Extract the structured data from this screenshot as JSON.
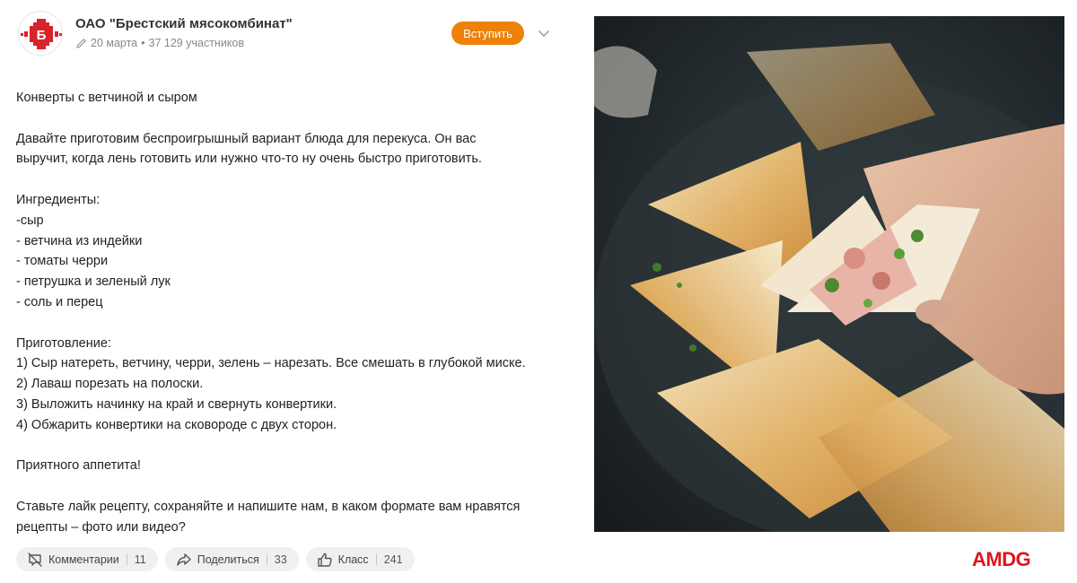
{
  "header": {
    "group_name": "ОАО \"Брестский мясокомбинат\"",
    "date": "20 марта",
    "members": "37 129 участников",
    "join_label": "Вступить",
    "icons": {
      "pencil": "pencil-icon",
      "more": "chevron-down-icon",
      "logo": "group-logo"
    }
  },
  "post": {
    "paragraphs": [
      [
        "Конверты с ветчиной и сыром"
      ],
      [
        "Давайте приготовим беспроигрышный вариант блюда для перекуса. Он вас",
        "выручит, когда лень готовить или нужно что-то ну очень быстро приготовить."
      ],
      [
        "Ингредиенты:",
        "-сыр",
        "- ветчина из индейки",
        "- томаты черри",
        "- петрушка и зеленый лук",
        "- соль и перец"
      ],
      [
        "Приготовление:",
        "1) Сыр натереть, ветчину, черри, зелень – нарезать. Все смешать в глубокой миске.",
        "2) Лаваш порезать на полоски.",
        "3) Выложить начинку на край и свернуть конвертики.",
        "4) Обжарить конвертики на сковороде с двух сторон."
      ],
      [
        "Приятного аппетита!"
      ],
      [
        "Ставьте лайк рецепту, сохраняйте и напишите нам, в каком формате вам нравятся",
        "рецепты – фото или видео?"
      ]
    ]
  },
  "actions": {
    "comments": {
      "label": "Комментарии",
      "count": "11",
      "icon": "comments-off-icon"
    },
    "share": {
      "label": "Поделиться",
      "count": "33",
      "icon": "share-icon"
    },
    "like": {
      "label": "Класс",
      "count": "241",
      "icon": "thumbs-up-icon"
    }
  },
  "photo": {
    "subject": "food-photo"
  },
  "watermark": {
    "text": "AMDG"
  },
  "colors": {
    "accent": "#ee8208",
    "brand_red": "#e1131b",
    "pill_bg": "#f0f0f0",
    "muted": "#888888"
  }
}
